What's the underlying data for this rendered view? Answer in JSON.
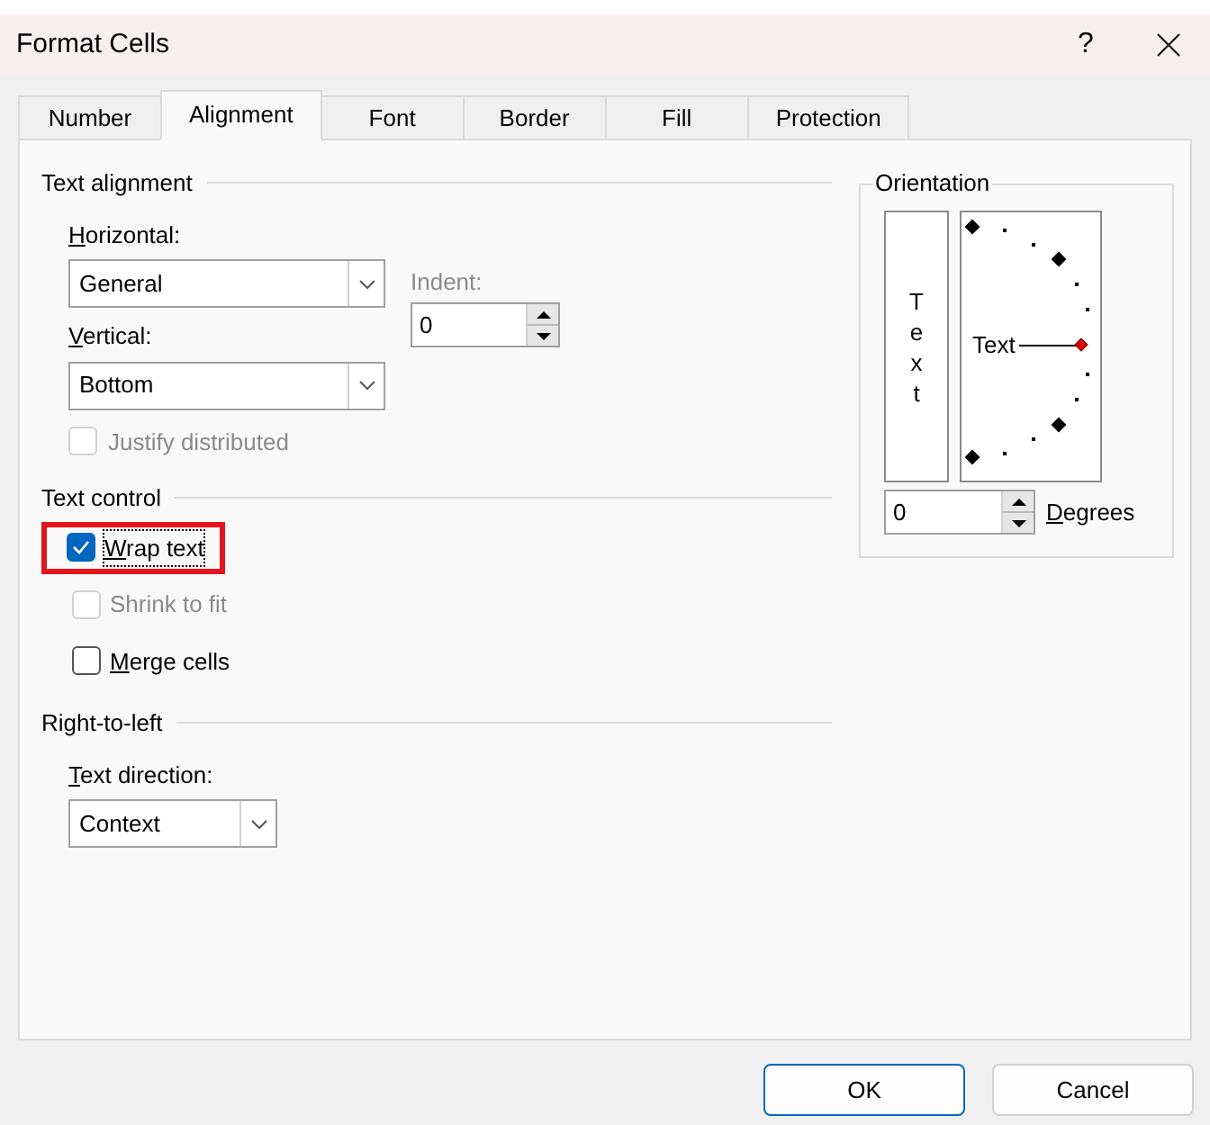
{
  "window": {
    "title": "Format Cells",
    "help": "?"
  },
  "tabs": [
    {
      "label": "Number",
      "selected": false
    },
    {
      "label": "Alignment",
      "selected": true
    },
    {
      "label": "Font",
      "selected": false
    },
    {
      "label": "Border",
      "selected": false
    },
    {
      "label": "Fill",
      "selected": false
    },
    {
      "label": "Protection",
      "selected": false
    }
  ],
  "text_alignment": {
    "heading": "Text alignment",
    "horizontal": {
      "label": "Horizontal:",
      "mnemonic": true,
      "value": "General"
    },
    "vertical": {
      "label": "Vertical:",
      "mnemonic": true,
      "value": "Bottom"
    },
    "indent": {
      "label": "Indent:",
      "value": "0",
      "disabled": true
    },
    "justify_distributed": {
      "label": "Justify distributed",
      "checked": false,
      "disabled": true
    }
  },
  "text_control": {
    "heading": "Text control",
    "options": [
      {
        "label": "Wrap text",
        "mnemonic": true,
        "checked": true,
        "disabled": false,
        "highlighted": true
      },
      {
        "label": "Shrink to fit",
        "mnemonic": false,
        "checked": false,
        "disabled": true,
        "highlighted": false
      },
      {
        "label": "Merge cells",
        "mnemonic": true,
        "checked": false,
        "disabled": false,
        "highlighted": false
      }
    ]
  },
  "right_to_left": {
    "heading": "Right-to-left",
    "text_direction": {
      "label": "Text direction:",
      "mnemonic": true,
      "value": "Context"
    }
  },
  "orientation": {
    "heading": "Orientation",
    "vertical_text": [
      "T",
      "e",
      "x",
      "t"
    ],
    "dial_text": "Text",
    "degrees": {
      "value": "0",
      "label": "Degrees",
      "mnemonic": true
    }
  },
  "buttons": [
    {
      "label": "OK",
      "default": true
    },
    {
      "label": "Cancel",
      "default": false
    }
  ]
}
